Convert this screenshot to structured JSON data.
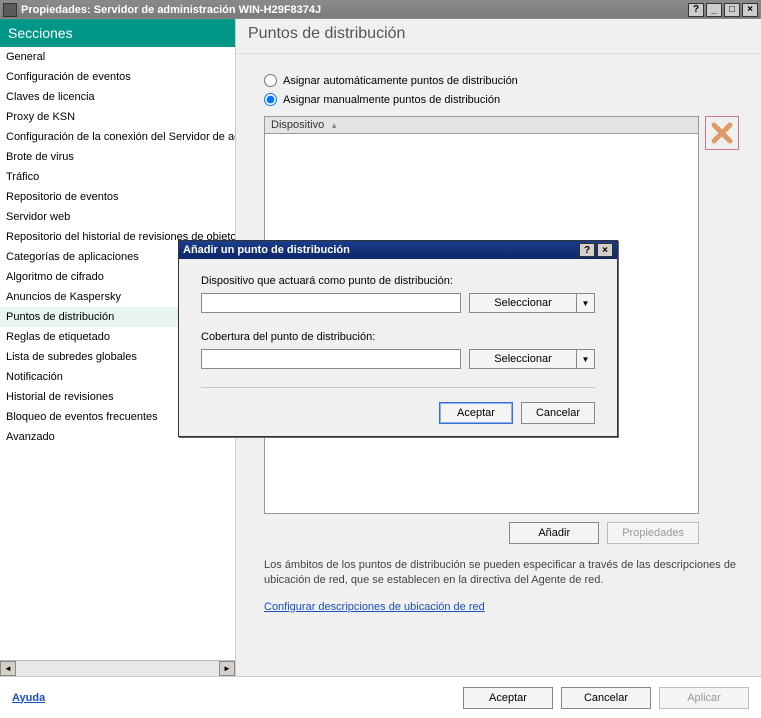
{
  "window": {
    "title": "Propiedades: Servidor de administración WIN-H29F8374J",
    "help_btn": "?",
    "min_btn": "_",
    "max_btn": "□",
    "close_btn": "×"
  },
  "sidebar": {
    "header": "Secciones",
    "items": [
      {
        "label": "General"
      },
      {
        "label": "Configuración de eventos"
      },
      {
        "label": "Claves de licencia"
      },
      {
        "label": "Proxy de KSN"
      },
      {
        "label": "Configuración de la conexión del Servidor de administración"
      },
      {
        "label": "Brote de virus"
      },
      {
        "label": "Tráfico"
      },
      {
        "label": "Repositorio de eventos"
      },
      {
        "label": "Servidor web"
      },
      {
        "label": "Repositorio del historial de revisiones de objetos"
      },
      {
        "label": "Categorías de aplicaciones"
      },
      {
        "label": "Algoritmo de cifrado"
      },
      {
        "label": "Anuncios de Kaspersky"
      },
      {
        "label": "Puntos de distribución",
        "selected": true
      },
      {
        "label": "Reglas de etiquetado"
      },
      {
        "label": "Lista de subredes globales"
      },
      {
        "label": "Notificación"
      },
      {
        "label": "Historial de revisiones"
      },
      {
        "label": "Bloqueo de eventos frecuentes"
      },
      {
        "label": "Avanzado"
      }
    ],
    "scroll_left": "◄",
    "scroll_right": "►"
  },
  "main": {
    "title": "Puntos de distribución",
    "radio_auto": "Asignar automáticamente puntos de distribución",
    "radio_manual": "Asignar manualmente puntos de distribución",
    "radio_selected": "manual",
    "list_header": "Dispositivo",
    "sort_indicator": "▲",
    "add_btn": "Añadir",
    "props_btn": "Propiedades",
    "info_text": "Los ámbitos de los puntos de distribución se pueden especificar a través de las descripciones de ubicación de red, que se establecen en la directiva del Agente de red.",
    "link_text": "Configurar descripciones de ubicación de red"
  },
  "modal": {
    "title": "Añadir un punto de distribución",
    "help_btn": "?",
    "close_btn": "×",
    "device_label": "Dispositivo que actuará como punto de distribución:",
    "device_value": "",
    "device_select": "Seleccionar",
    "coverage_label": "Cobertura del punto de distribución:",
    "coverage_value": "",
    "coverage_select": "Seleccionar",
    "dropdown_arrow": "▼",
    "ok_btn": "Aceptar",
    "cancel_btn": "Cancelar"
  },
  "footer": {
    "help": "Ayuda",
    "ok": "Aceptar",
    "cancel": "Cancelar",
    "apply": "Aplicar"
  }
}
